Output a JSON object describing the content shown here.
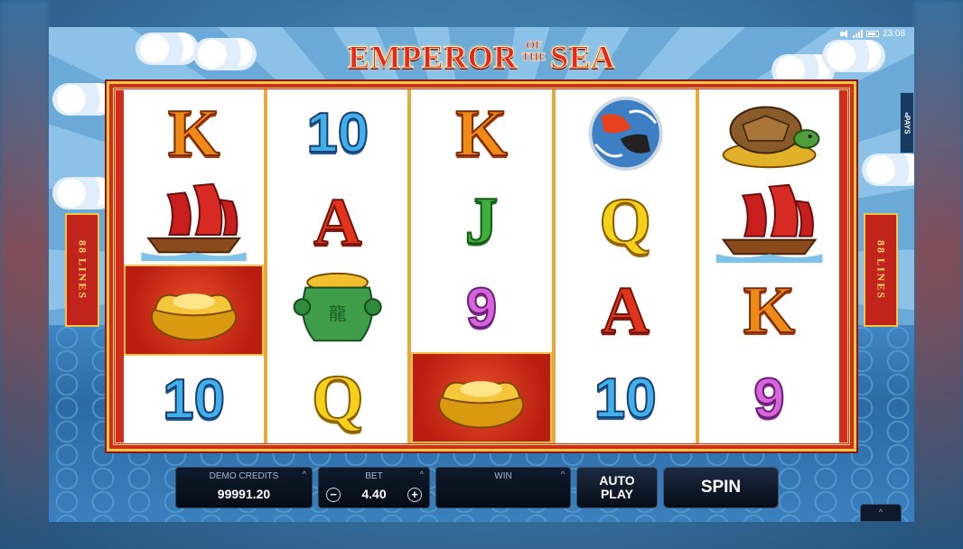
{
  "title": {
    "main_left": "EMPEROR",
    "small_top": "OF",
    "small_bottom": "THE",
    "main_right": "SEA"
  },
  "status": {
    "time": "23:08"
  },
  "lines_badge": {
    "count": "88",
    "word": "LINES"
  },
  "pays_tab": {
    "label": "PAYS",
    "arrow": "«"
  },
  "reels": [
    [
      "K",
      "ship",
      "gold-ingot",
      "10"
    ],
    [
      "10",
      "A",
      "jade-urn",
      "Q"
    ],
    [
      "K",
      "J",
      "9",
      "gold-ingot"
    ],
    [
      "koi-fish",
      "Q",
      "A",
      "10"
    ],
    [
      "turtle",
      "ship",
      "K",
      "9"
    ]
  ],
  "bottom_bar": {
    "credits_label": "DEMO CREDITS",
    "credits_value": "99991.20",
    "bet_label": "BET",
    "bet_value": "4.40",
    "bet_minus": "−",
    "bet_plus": "+",
    "win_label": "WIN",
    "win_value": "",
    "caret": "^",
    "auto_play_line1": "AUTO",
    "auto_play_line2": "PLAY",
    "spin_label": "SPIN"
  },
  "colors": {
    "frame_red": "#d42c1b",
    "frame_gold": "#f4c34a",
    "sky_blue": "#6aa9d8",
    "panel_dark": "#0f1a2b"
  }
}
